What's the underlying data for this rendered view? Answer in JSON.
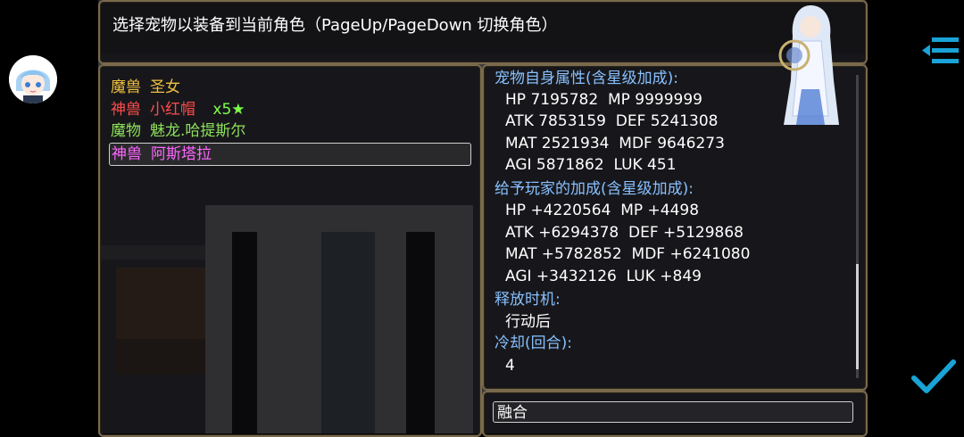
{
  "help": {
    "text": "选择宠物以装备到当前角色（PageUp/PageDown 切换角色）"
  },
  "colors": {
    "window_border": "#7a6a4d",
    "system_blue": "#88c0ff",
    "accent_cyan": "#19a3d6"
  },
  "pet_list": [
    {
      "type": "魔兽",
      "name": "圣女",
      "extra": "",
      "color": "#f0c040"
    },
    {
      "type": "神兽",
      "name": "小红帽",
      "extra": "x5★",
      "color": "#ff4b4b",
      "extra_color": "#7cff4b"
    },
    {
      "type": "魔物",
      "name": "魅龙.哈提斯尔",
      "extra": "",
      "color": "#8ee05a"
    },
    {
      "type": "神兽",
      "name": "阿斯塔拉",
      "extra": "",
      "color": "#ff66ff",
      "selected": true
    }
  ],
  "details": {
    "self_header": "宠物自身属性(含星级加成):",
    "self_lines": [
      "HP 7195782  MP 9999999",
      "ATK 7853159  DEF 5241308",
      "MAT 2521934  MDF 9646273",
      "AGI 5871862  LUK 451"
    ],
    "bonus_header": "给予玩家的加成(含星级加成):",
    "bonus_lines": [
      "HP +4220564  MP +4498",
      "ATK +6294378  DEF +5129868",
      "MAT +5782852  MDF +6241080",
      "AGI +3432126  LUK +849"
    ],
    "timing_header": "释放时机:",
    "timing_value": "行动后",
    "cooldown_header": "冷却(回合):",
    "cooldown_value": "4"
  },
  "command": {
    "fuse_label": "融合"
  },
  "icons": {
    "menu": "menu-list-icon",
    "confirm": "checkmark-icon",
    "avatar": "character-avatar"
  }
}
